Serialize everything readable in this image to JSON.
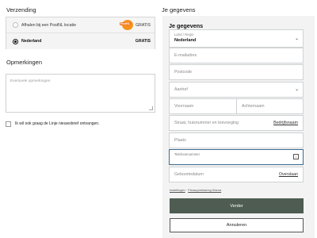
{
  "shipping": {
    "heading": "Verzending",
    "options": [
      {
        "label": "Afhalen bij een PostNL locatie",
        "price": "GRATIS",
        "selected": false
      },
      {
        "label": "Nederland",
        "price": "GRATIS",
        "selected": true
      }
    ],
    "carrier_icon": "postnl-logo",
    "carrier_icon_text": "PostNL",
    "carrier_color": "#f7931d"
  },
  "remarks": {
    "heading": "Opmerkingen",
    "placeholder": "Eventuele opmerkingen"
  },
  "newsletter": {
    "label": "Ik wil ook graag de Linje nieuwsbrief ontvangen.",
    "checked": false
  },
  "details": {
    "heading": "Je gegevens",
    "subheading": "Je gegevens",
    "country": {
      "label": "Land / Regio",
      "value": "Nederland"
    },
    "email_placeholder": "E-mailadres",
    "postcode_placeholder": "Postcode",
    "salutation_placeholder": "Aanhef",
    "firstname_placeholder": "Voornaam",
    "lastname_placeholder": "Achternaam",
    "street_placeholder": "Straat, huisnummer en toevoeging",
    "company_link": "Bedrijfsnaam",
    "city_placeholder": "Plaats",
    "phone_label": "Telefoonnummer",
    "birthdate_placeholder": "Geboortedatum",
    "skip_link": "Overslaan",
    "legal_terms": "Instellingen",
    "legal_sep": " · ",
    "legal_privacy": "Privacyverklaring Klarna",
    "next_button": "Verder",
    "cancel_button": "Annuleren"
  },
  "colors": {
    "primary_button": "#4e5c51",
    "panel_bg": "#f3f3f3",
    "focus_border": "#3d6b8f"
  }
}
